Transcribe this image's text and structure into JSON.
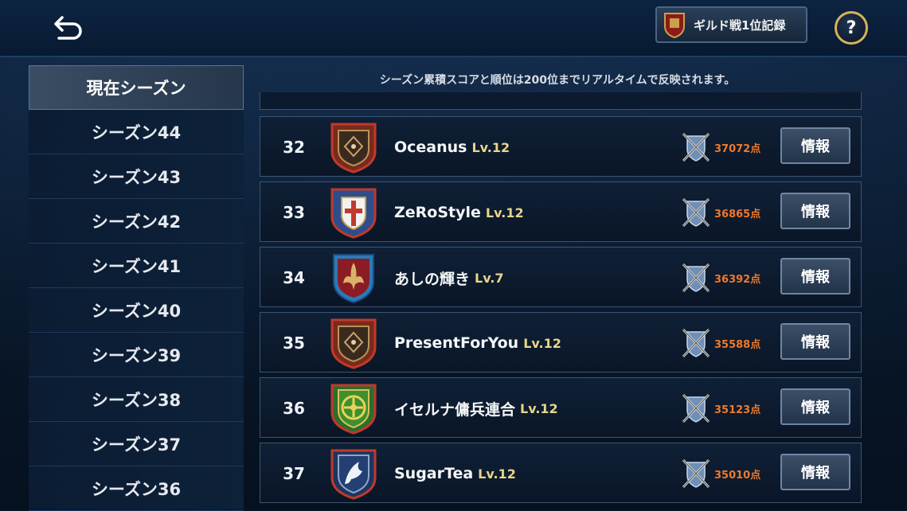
{
  "header": {
    "record_label": "ギルド戦1位記録",
    "help_label": "?"
  },
  "sidebar": {
    "items": [
      {
        "label": "現在シーズン",
        "active": true
      },
      {
        "label": "シーズン44"
      },
      {
        "label": "シーズン43"
      },
      {
        "label": "シーズン42"
      },
      {
        "label": "シーズン41"
      },
      {
        "label": "シーズン40"
      },
      {
        "label": "シーズン39"
      },
      {
        "label": "シーズン38"
      },
      {
        "label": "シーズン37"
      },
      {
        "label": "シーズン36"
      }
    ]
  },
  "notice": "シーズン累積スコアと順位は200位までリアルタイムで反映されます。",
  "rankings": [
    {
      "rank": "32",
      "name": "Oceanus",
      "level": "Lv.12",
      "score": "37072点",
      "button": "情報",
      "emblem": "crest-brown-icon"
    },
    {
      "rank": "33",
      "name": "ZeRoStyle",
      "level": "Lv.12",
      "score": "36865点",
      "button": "情報",
      "emblem": "cross-shield-icon"
    },
    {
      "rank": "34",
      "name": "あしの輝き",
      "level": "Lv.7",
      "score": "36392点",
      "button": "情報",
      "emblem": "fleur-shield-icon"
    },
    {
      "rank": "35",
      "name": "PresentForYou",
      "level": "Lv.12",
      "score": "35588点",
      "button": "情報",
      "emblem": "crest-brown-icon"
    },
    {
      "rank": "36",
      "name": "イセルナ傭兵連合",
      "level": "Lv.12",
      "score": "35123点",
      "button": "情報",
      "emblem": "green-emblem-icon"
    },
    {
      "rank": "37",
      "name": "SugarTea",
      "level": "Lv.12",
      "score": "35010点",
      "button": "情報",
      "emblem": "pegasus-shield-icon"
    }
  ],
  "colors": {
    "accent_gold": "#d6b25a",
    "score_orange": "#f0792a",
    "level_yellow": "#e8d58a"
  }
}
